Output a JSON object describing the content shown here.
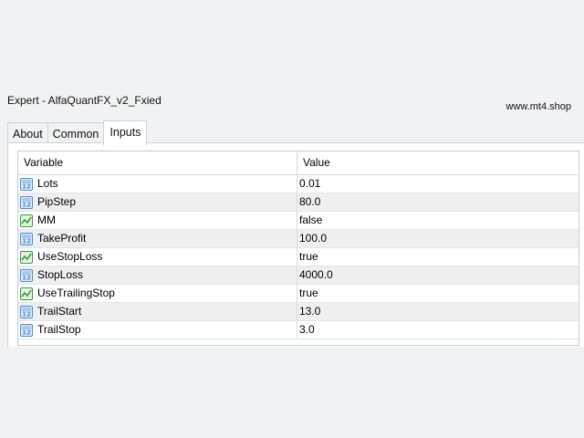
{
  "window": {
    "title": "Expert - AlfaQuantFX_v2_Fxied",
    "watermark": "www.mt4.shop"
  },
  "tabs": [
    {
      "label": "About",
      "active": false
    },
    {
      "label": "Common",
      "active": false
    },
    {
      "label": "Inputs",
      "active": true
    }
  ],
  "table": {
    "headers": {
      "variable": "Variable",
      "value": "Value"
    },
    "rows": [
      {
        "variable": "Lots",
        "value": "0.01",
        "icon": "numeric-param-icon"
      },
      {
        "variable": "PipStep",
        "value": "80.0",
        "icon": "numeric-param-icon"
      },
      {
        "variable": "MM",
        "value": "false",
        "icon": "boolean-param-icon"
      },
      {
        "variable": "TakeProfit",
        "value": "100.0",
        "icon": "numeric-param-icon"
      },
      {
        "variable": "UseStopLoss",
        "value": "true",
        "icon": "boolean-param-icon"
      },
      {
        "variable": "StopLoss",
        "value": "4000.0",
        "icon": "numeric-param-icon"
      },
      {
        "variable": "UseTrailingStop",
        "value": "true",
        "icon": "boolean-param-icon"
      },
      {
        "variable": "TrailStart",
        "value": "13.0",
        "icon": "numeric-param-icon"
      },
      {
        "variable": "TrailStop",
        "value": "3.0",
        "icon": "numeric-param-icon"
      }
    ]
  },
  "colors": {
    "numeric_icon": "#4f8fcf",
    "boolean_icon": "#3b9e3b",
    "alt_row": "#efefef"
  }
}
